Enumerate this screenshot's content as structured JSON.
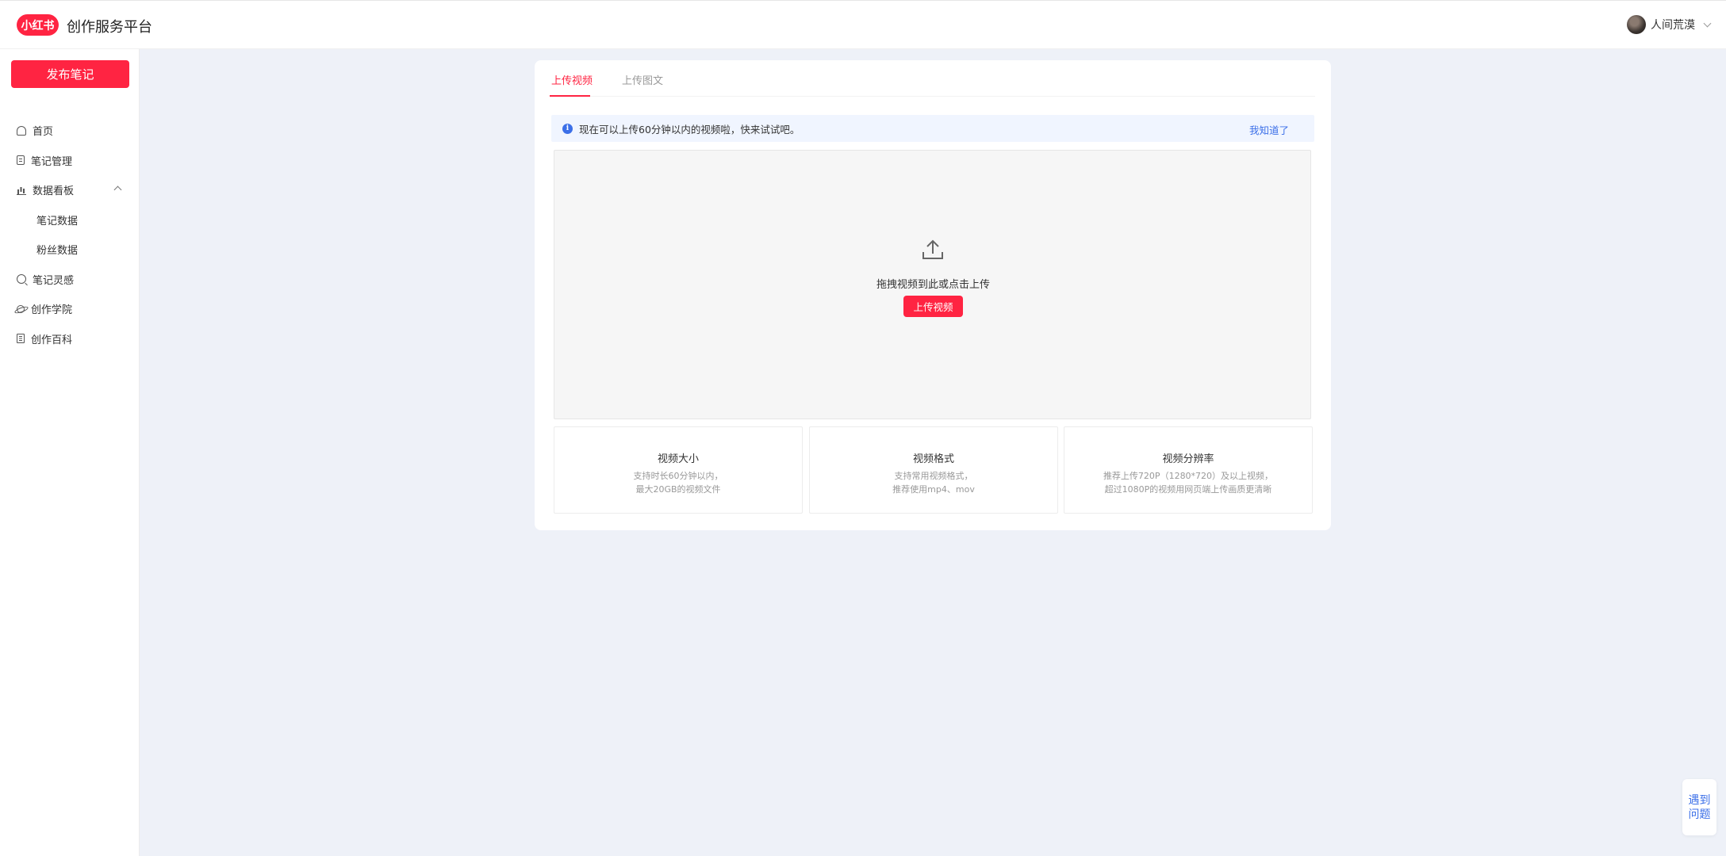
{
  "header": {
    "logo_text": "小红书",
    "brand": "创作服务平台",
    "username": "人间荒漠"
  },
  "sidebar": {
    "publish_label": "发布笔记",
    "items": [
      {
        "label": "首页",
        "icon": "home-icon"
      },
      {
        "label": "笔记管理",
        "icon": "note-icon"
      },
      {
        "label": "数据看板",
        "icon": "chart-icon",
        "expanded": true
      },
      {
        "label": "笔记数据",
        "sub": true
      },
      {
        "label": "粉丝数据",
        "sub": true
      },
      {
        "label": "笔记灵感",
        "icon": "inspiration-icon"
      },
      {
        "label": "创作学院",
        "icon": "planet-icon"
      },
      {
        "label": "创作百科",
        "icon": "book-icon"
      }
    ]
  },
  "main": {
    "tabs": [
      {
        "label": "上传视频",
        "active": true
      },
      {
        "label": "上传图文",
        "active": false
      }
    ],
    "notice": {
      "text": "现在可以上传60分钟以内的视频啦，快来试试吧。",
      "link": "我知道了"
    },
    "dropzone": {
      "hint": "拖拽视频到此或点击上传",
      "button": "上传视频"
    },
    "info_boxes": [
      {
        "title": "视频大小",
        "lines": [
          "支持时长60分钟以内，",
          "最大20GB的视频文件"
        ]
      },
      {
        "title": "视频格式",
        "lines": [
          "支持常用视频格式，",
          "推荐使用mp4、mov"
        ]
      },
      {
        "title": "视频分辨率",
        "lines": [
          "推荐上传720P（1280*720）及以上视频，",
          "超过1080P的视频用网页端上传画质更清晰"
        ]
      }
    ]
  },
  "help": {
    "label": "遇到问题"
  },
  "colors": {
    "accent": "#ff2442",
    "link": "#3b6fe8",
    "background": "#eef1f8"
  }
}
